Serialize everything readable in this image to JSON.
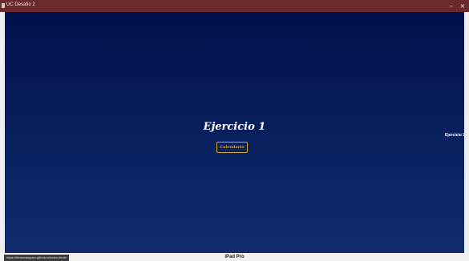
{
  "window": {
    "title": "UC Desafio 2",
    "minimize_glyph": "–",
    "close_glyph": "×"
  },
  "page": {
    "heading": "Ejercicio 1",
    "calendar_button": "Calendario",
    "next_link": "Ejercicio 2"
  },
  "statusbar": {
    "url": "https://hiramvasquez.github.io/index.html#",
    "device": "iPad Pro"
  },
  "colors": {
    "titlebar": "#6b2a2e",
    "background_top": "#01104a",
    "background_bottom": "#102c6d",
    "accent": "#e0ac2c"
  },
  "icons": {
    "app": "app-icon",
    "minimize": "minimize-icon",
    "close": "close-icon"
  }
}
